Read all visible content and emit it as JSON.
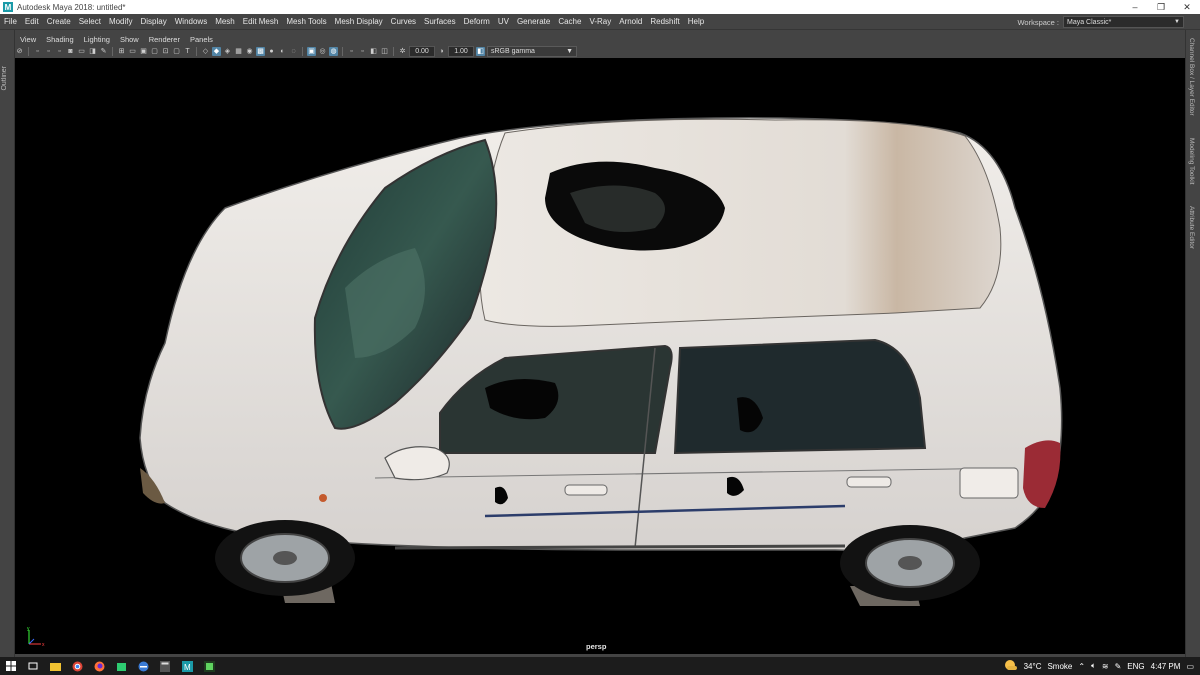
{
  "window": {
    "title": "Autodesk Maya 2018: untitled*",
    "app_icon_letter": "M",
    "controls": {
      "minimize": "–",
      "restore": "❐",
      "close": "✕"
    }
  },
  "menubar": {
    "items": [
      "File",
      "Edit",
      "Create",
      "Select",
      "Modify",
      "Display",
      "Windows",
      "Mesh",
      "Edit Mesh",
      "Mesh Tools",
      "Mesh Display",
      "Curves",
      "Surfaces",
      "Deform",
      "UV",
      "Generate",
      "Cache",
      "V-Ray",
      "Arnold",
      "Redshift",
      "Help"
    ],
    "workspace_label": "Workspace :",
    "workspace_value": "Maya Classic*"
  },
  "left_panel": {
    "tab_label": "Outliner"
  },
  "right_panel": {
    "tabs": [
      "Channel Box / Layer Editor",
      "Modeling Toolkit",
      "Attribute Editor"
    ]
  },
  "panel_menu": {
    "items": [
      "View",
      "Shading",
      "Lighting",
      "Show",
      "Renderer",
      "Panels"
    ]
  },
  "toolbar": {
    "exposure_value": "0.00",
    "gamma_value": "1.00",
    "colorspace": "sRGB gamma"
  },
  "viewport": {
    "camera_label": "persp",
    "background": "#000000",
    "axis_labels": {
      "y": "y",
      "x": "x"
    }
  },
  "taskbar": {
    "weather_temp": "34°C",
    "weather_text": "Smoke",
    "language": "ENG",
    "time": "4:47 PM"
  },
  "colors": {
    "accent": "#5285a6",
    "maya_teal": "#1b9aa8",
    "car_body": "#e6e1dc"
  }
}
